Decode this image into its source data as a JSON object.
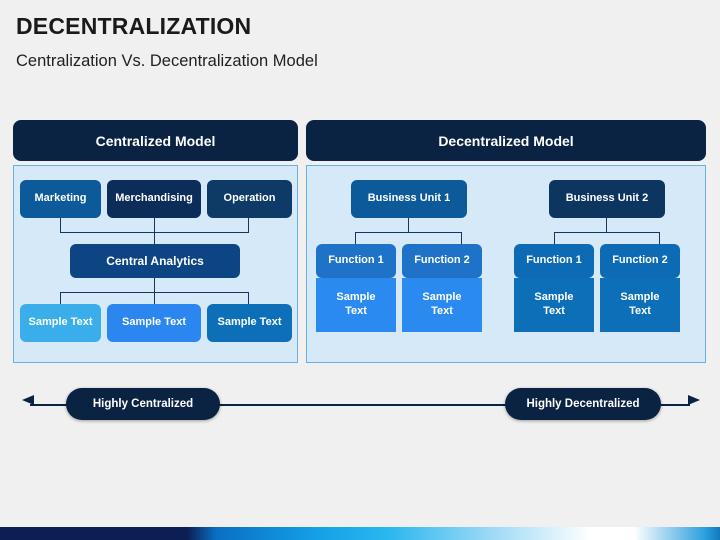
{
  "header": {
    "title": "DECENTRALIZATION",
    "subtitle": "Centralization Vs. Decentralization Model"
  },
  "colors": {
    "page_background": "#f0f0f0",
    "header_bar": "#0a2342",
    "panel_fill": "#d6e9f8",
    "panel_border": "#6ab0e4",
    "connector": "#14375e",
    "text_on_dark": "#ffffff"
  },
  "centralized": {
    "header_label": "Centralized Model",
    "top_row": [
      {
        "label": "Marketing",
        "color": "#0d5a9a"
      },
      {
        "label": "Merchandising",
        "color": "#0c2d5a"
      },
      {
        "label": "Operation",
        "color": "#0d3a66"
      }
    ],
    "hub": {
      "label": "Central Analytics",
      "color": "#0d4584"
    },
    "bottom_row": [
      {
        "label": "Sample Text",
        "color": "#3aaeeb"
      },
      {
        "label": "Sample Text",
        "color": "#2b86ef"
      },
      {
        "label": "Sample Text",
        "color": "#0c6fb8"
      }
    ]
  },
  "decentralized": {
    "header_label": "Decentralized Model",
    "units": [
      {
        "label": "Business Unit 1",
        "color": "#0d5a9a",
        "functions": [
          {
            "label": "Function 1",
            "color": "#1e72c8"
          },
          {
            "label": "Function 2",
            "color": "#1e72c8"
          }
        ],
        "samples": [
          {
            "label": "Sample\nText",
            "line1": "Sample",
            "line2": "Text",
            "color": "#2b8aef"
          },
          {
            "label": "Sample\nText",
            "line1": "Sample",
            "line2": "Text",
            "color": "#2b8aef"
          }
        ]
      },
      {
        "label": "Business Unit 2",
        "color": "#0c3560",
        "functions": [
          {
            "label": "Function 1",
            "color": "#0d6bb5"
          },
          {
            "label": "Function 2",
            "color": "#0d6bb5"
          }
        ],
        "samples": [
          {
            "label": "Sample\nText",
            "line1": "Sample",
            "line2": "Text",
            "color": "#0c6fb8"
          },
          {
            "label": "Sample\nText",
            "line1": "Sample",
            "line2": "Text",
            "color": "#0c6fb8"
          }
        ]
      }
    ]
  },
  "axis": {
    "left_pill_label": "Highly Centralized",
    "right_pill_label": "Highly Decentralized",
    "left_arrow_icon": "arrow-left-icon",
    "right_arrow_icon": "arrow-right-icon"
  }
}
